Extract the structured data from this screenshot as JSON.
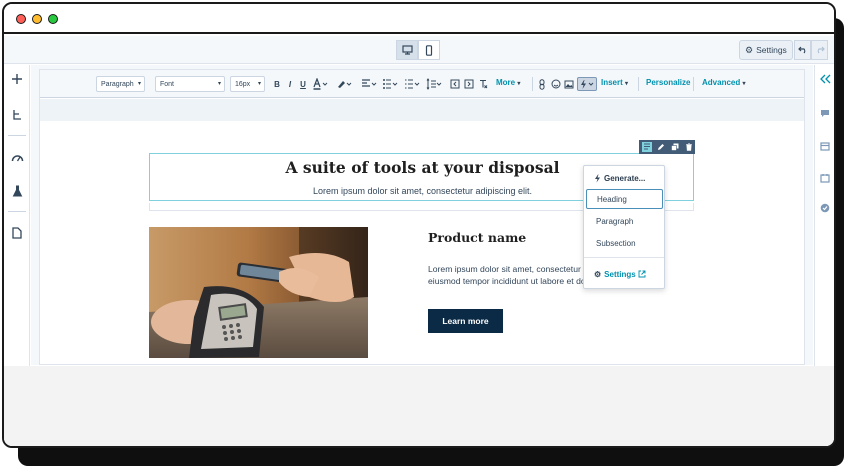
{
  "window": {
    "controls": [
      "close",
      "minimize",
      "maximize"
    ],
    "dot_colors": [
      "#ff5f57",
      "#febc2e",
      "#28c840"
    ]
  },
  "topbar": {
    "device_toggle": [
      "desktop-icon",
      "mobile-icon"
    ],
    "active_device": "desktop",
    "settings_label": "Settings",
    "undo_icons": [
      "undo-icon",
      "redo-icon"
    ]
  },
  "left_rail": {
    "icons": [
      "plus-icon",
      "tree-icon",
      "gauge-icon",
      "flask-icon",
      "page-icon"
    ]
  },
  "right_rail": {
    "icons": [
      "collapse-icon",
      "comment-icon",
      "layout-icon",
      "calendar-icon",
      "check-icon"
    ]
  },
  "toolbar": {
    "paragraph": "Paragraph",
    "font": "Font",
    "size": "16px",
    "bold": "B",
    "italic": "I",
    "underline": "U",
    "more": "More",
    "insert": "Insert",
    "personalize": "Personalize",
    "advanced": "Advanced",
    "caret": "▾"
  },
  "dropdown": {
    "generate": "Generate...",
    "heading": "Heading",
    "paragraph": "Paragraph",
    "subsection": "Subsection",
    "settings": "Settings"
  },
  "content": {
    "heading": "A suite of tools at your disposal",
    "subtext": "Lorem ipsum dolor sit amet, consectetur adipiscing elit.",
    "product_title": "Product name",
    "product_desc": "Lorem ipsum dolor sit amet, consectetur adipiscing elit, sed do eiusmod tempor incididunt ut labore et dolore magna aliqua.",
    "button": "Learn more"
  },
  "colors": {
    "accent": "#0091ae",
    "dark_button": "#0b2a45",
    "selection": "#7fd1de",
    "module_tools": "#425b76"
  }
}
